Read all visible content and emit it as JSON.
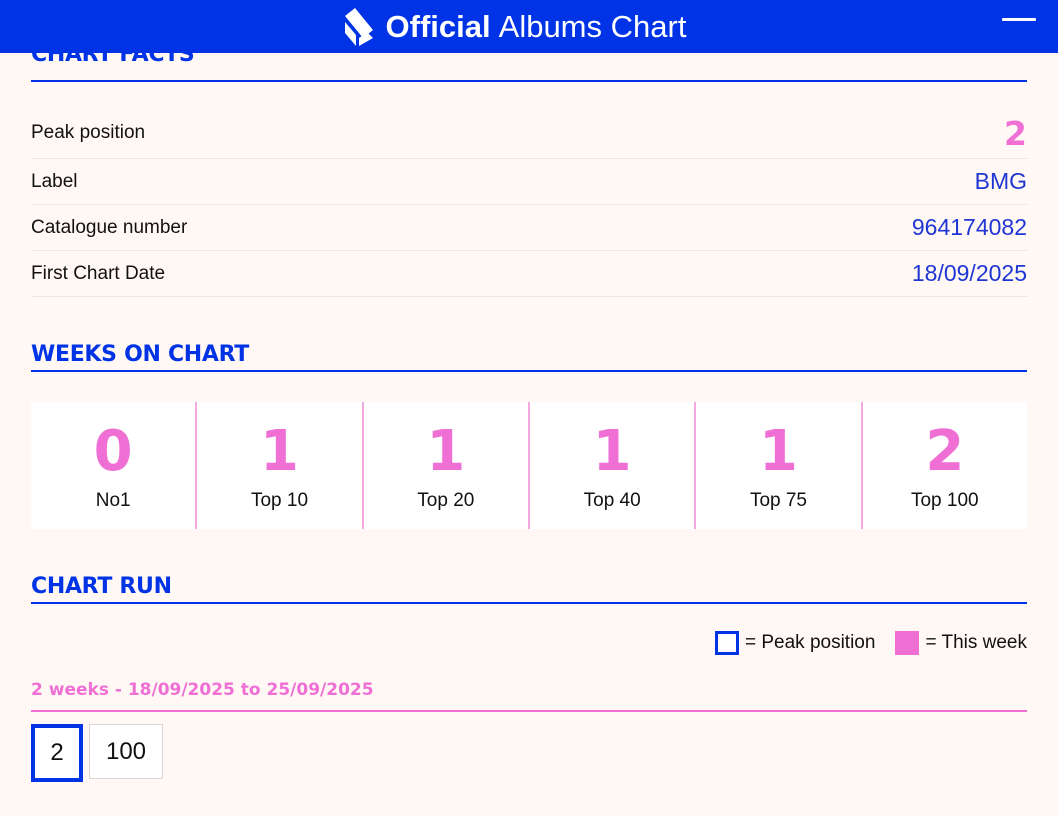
{
  "header": {
    "title_bold": "Official",
    "title_light": "Albums Chart",
    "logo_icon": "official-charts-logo-icon",
    "menu_icon": "hamburger-menu-icon"
  },
  "chart_facts": {
    "title": "CHART FACTS",
    "rows": [
      {
        "label": "Peak position",
        "value": "2"
      },
      {
        "label": "Label",
        "value": "BMG"
      },
      {
        "label": "Catalogue number",
        "value": "964174082"
      },
      {
        "label": "First Chart Date",
        "value": "18/09/2025"
      }
    ]
  },
  "weeks_on_chart": {
    "title": "WEEKS ON CHART",
    "items": [
      {
        "value": "0",
        "label": "No1"
      },
      {
        "value": "1",
        "label": "Top 10"
      },
      {
        "value": "1",
        "label": "Top 20"
      },
      {
        "value": "1",
        "label": "Top 40"
      },
      {
        "value": "1",
        "label": "Top 75"
      },
      {
        "value": "2",
        "label": "Top 100"
      }
    ]
  },
  "chart_run": {
    "title": "CHART RUN",
    "legend": {
      "peak": "= Peak position",
      "this_week": "= This week"
    },
    "range": "2 weeks - 18/09/2025 to 25/09/2025",
    "positions": [
      "2",
      "100"
    ]
  },
  "colors": {
    "brand_blue": "#0033e6",
    "accent_pink": "#ef6fd4",
    "background": "#fff8f4"
  }
}
